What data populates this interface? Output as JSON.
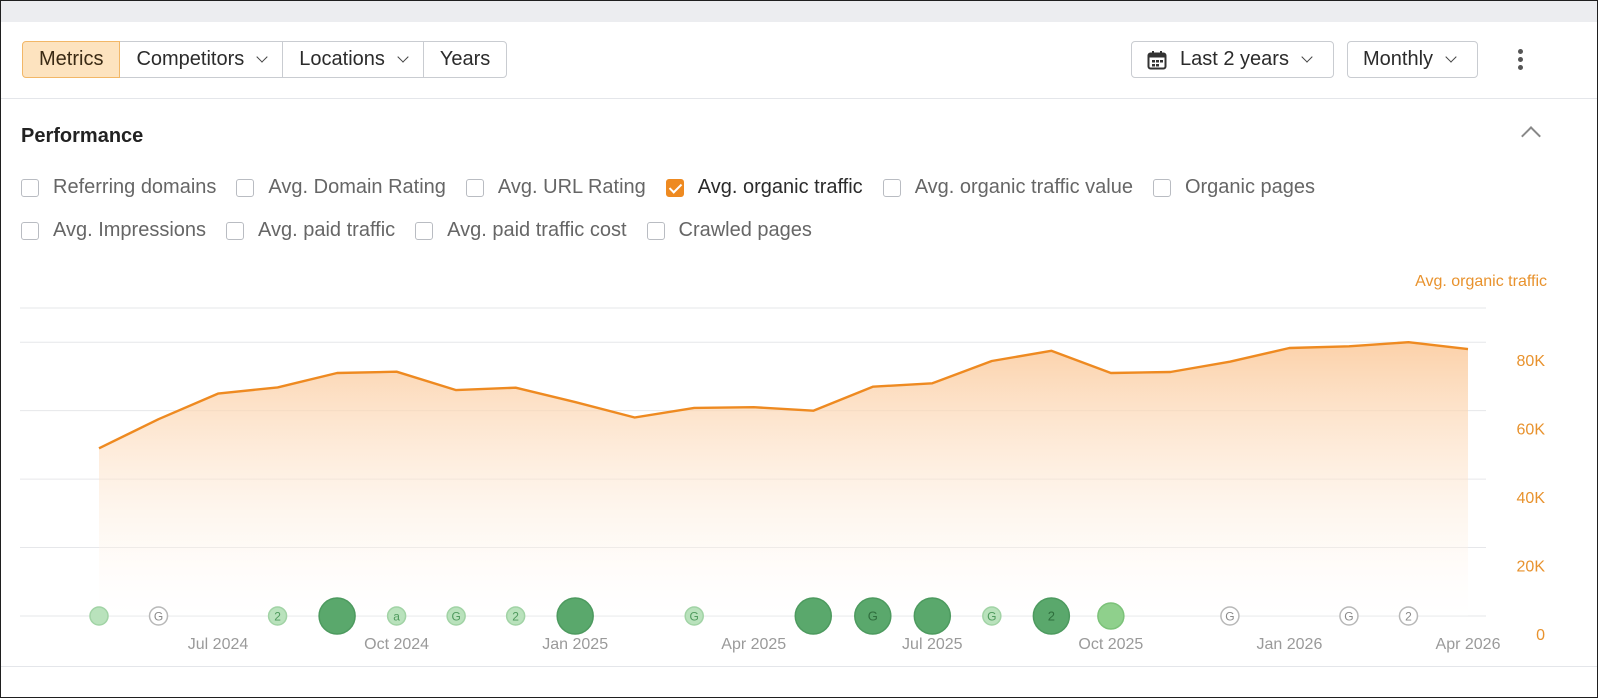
{
  "toolbar": {
    "tabs": [
      {
        "label": "Metrics",
        "active": true
      },
      {
        "label": "Competitors",
        "dropdown": true
      },
      {
        "label": "Locations",
        "dropdown": true
      },
      {
        "label": "Years",
        "dropdown": false
      }
    ],
    "range_label": "Last 2 years",
    "interval_label": "Monthly"
  },
  "section": {
    "title": "Performance",
    "metrics_row1": [
      {
        "label": "Referring domains",
        "checked": false
      },
      {
        "label": "Avg. Domain Rating",
        "checked": false
      },
      {
        "label": "Avg. URL Rating",
        "checked": false
      },
      {
        "label": "Avg. organic traffic",
        "checked": true
      },
      {
        "label": "Avg. organic traffic value",
        "checked": false
      },
      {
        "label": "Organic pages",
        "checked": false
      }
    ],
    "metrics_row2": [
      {
        "label": "Avg. Impressions",
        "checked": false
      },
      {
        "label": "Avg. paid traffic",
        "checked": false
      },
      {
        "label": "Avg. paid traffic cost",
        "checked": false
      },
      {
        "label": "Crawled pages",
        "checked": false
      }
    ]
  },
  "colors": {
    "accent": "#ee8a21",
    "area_top": "#fbc99a",
    "marker_dark": "#5aa86c",
    "marker_light": "#a7d7ad"
  },
  "chart_data": {
    "type": "area",
    "x_start": "2024-05",
    "x": [
      "2024-05",
      "2024-06",
      "2024-07",
      "2024-08",
      "2024-09",
      "2024-10",
      "2024-11",
      "2024-12",
      "2025-01",
      "2025-02",
      "2025-03",
      "2025-04",
      "2025-05",
      "2025-06",
      "2025-07",
      "2025-08",
      "2025-09",
      "2025-10",
      "2025-11",
      "2025-12",
      "2026-01",
      "2026-02",
      "2026-03",
      "2026-04"
    ],
    "series": [
      {
        "name": "Avg. organic traffic",
        "values": [
          49000,
          57500,
          65000,
          66800,
          71000,
          71400,
          66000,
          66700,
          62500,
          58000,
          60800,
          61000,
          60000,
          67000,
          68000,
          74500,
          77500,
          71000,
          71300,
          74300,
          78300,
          78800,
          80000,
          78000
        ]
      }
    ],
    "ylim": [
      0,
      90000
    ],
    "y_ticks": [
      "0",
      "20K",
      "40K",
      "60K",
      "80K"
    ],
    "y_tick_values": [
      0,
      20000,
      40000,
      60000,
      80000
    ],
    "x_ticks": [
      {
        "label": "Jul 2024",
        "x": "2024-07"
      },
      {
        "label": "Oct 2024",
        "x": "2024-10"
      },
      {
        "label": "Jan 2025",
        "x": "2025-01"
      },
      {
        "label": "Apr 2025",
        "x": "2025-04"
      },
      {
        "label": "Jul 2025",
        "x": "2025-07"
      },
      {
        "label": "Oct 2025",
        "x": "2025-10"
      },
      {
        "label": "Jan 2026",
        "x": "2026-01"
      },
      {
        "label": "Apr 2026",
        "x": "2026-04"
      }
    ],
    "grid": true,
    "y_axis_position": "right",
    "events": [
      {
        "x": "2024-05",
        "size": "small",
        "style": "light",
        "label": ""
      },
      {
        "x": "2024-06",
        "size": "small",
        "style": "outline",
        "label": "G"
      },
      {
        "x": "2024-08",
        "size": "small",
        "style": "light",
        "label": "2"
      },
      {
        "x": "2024-09",
        "size": "large",
        "style": "dark",
        "label": ""
      },
      {
        "x": "2024-10",
        "size": "small",
        "style": "light",
        "label": "a"
      },
      {
        "x": "2024-11",
        "size": "small",
        "style": "light",
        "label": "G"
      },
      {
        "x": "2024-12",
        "size": "small",
        "style": "light",
        "label": "2"
      },
      {
        "x": "2025-01",
        "size": "large",
        "style": "dark",
        "label": ""
      },
      {
        "x": "2025-03",
        "size": "small",
        "style": "light",
        "label": "G"
      },
      {
        "x": "2025-05",
        "size": "large",
        "style": "dark",
        "label": ""
      },
      {
        "x": "2025-06",
        "size": "large",
        "style": "dark",
        "label": "G"
      },
      {
        "x": "2025-07",
        "size": "large",
        "style": "dark",
        "label": ""
      },
      {
        "x": "2025-08",
        "size": "small",
        "style": "light",
        "label": "G"
      },
      {
        "x": "2025-09",
        "size": "large",
        "style": "dark",
        "label": "2"
      },
      {
        "x": "2025-10",
        "size": "medium",
        "style": "mid",
        "label": ""
      },
      {
        "x": "2025-12",
        "size": "small",
        "style": "outline",
        "label": "G"
      },
      {
        "x": "2026-02",
        "size": "small",
        "style": "outline",
        "label": "G"
      },
      {
        "x": "2026-03",
        "size": "small",
        "style": "outline",
        "label": "2"
      }
    ]
  }
}
